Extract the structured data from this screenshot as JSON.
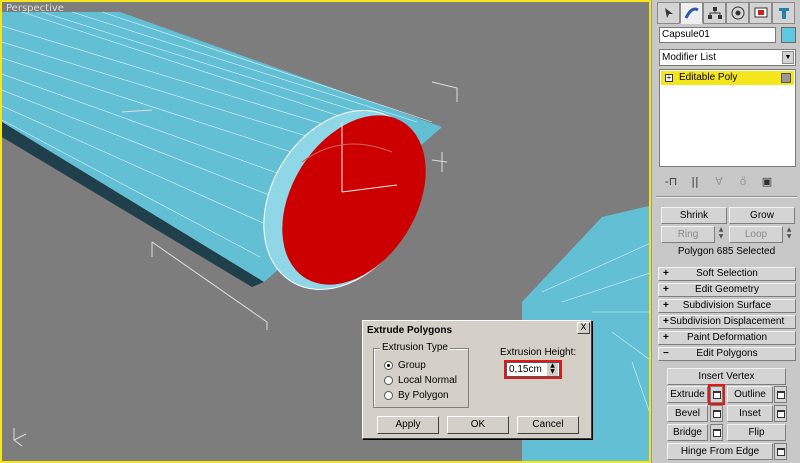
{
  "viewport": {
    "label": "Perspective",
    "highlight_color": "#f5e61c",
    "object_color": "#5ec8e0",
    "selection_color": "#cc0000"
  },
  "panel": {
    "tabs": [
      "create-icon",
      "modify-icon",
      "hierarchy-icon",
      "motion-icon",
      "display-icon",
      "utilities-icon"
    ],
    "object_name": "Capsule01",
    "modifier_list": "Modifier List",
    "stack_item": "Editable Poly",
    "selection": {
      "shrink": "Shrink",
      "grow": "Grow",
      "ring": "Ring",
      "loop": "Loop",
      "info": "Polygon 685 Selected"
    },
    "rollouts": {
      "soft_selection": "Soft Selection",
      "edit_geometry": "Edit Geometry",
      "subdivision_surface": "Subdivision Surface",
      "subdivision_displacement": "Subdivision Displacement",
      "paint_deformation": "Paint Deformation",
      "edit_polygons": "Edit Polygons"
    },
    "edit_polygons": {
      "insert_vertex": "Insert Vertex",
      "extrude": "Extrude",
      "outline": "Outline",
      "bevel": "Bevel",
      "inset": "Inset",
      "bridge": "Bridge",
      "flip": "Flip",
      "hinge": "Hinge From Edge"
    }
  },
  "dialog": {
    "title": "Extrude Polygons",
    "group_title": "Extrusion Type",
    "options": [
      "Group",
      "Local Normal",
      "By Polygon"
    ],
    "selected": "Group",
    "height_label": "Extrusion Height:",
    "height_value": "0,15cm",
    "apply": "Apply",
    "ok": "OK",
    "cancel": "Cancel",
    "close": "X"
  }
}
